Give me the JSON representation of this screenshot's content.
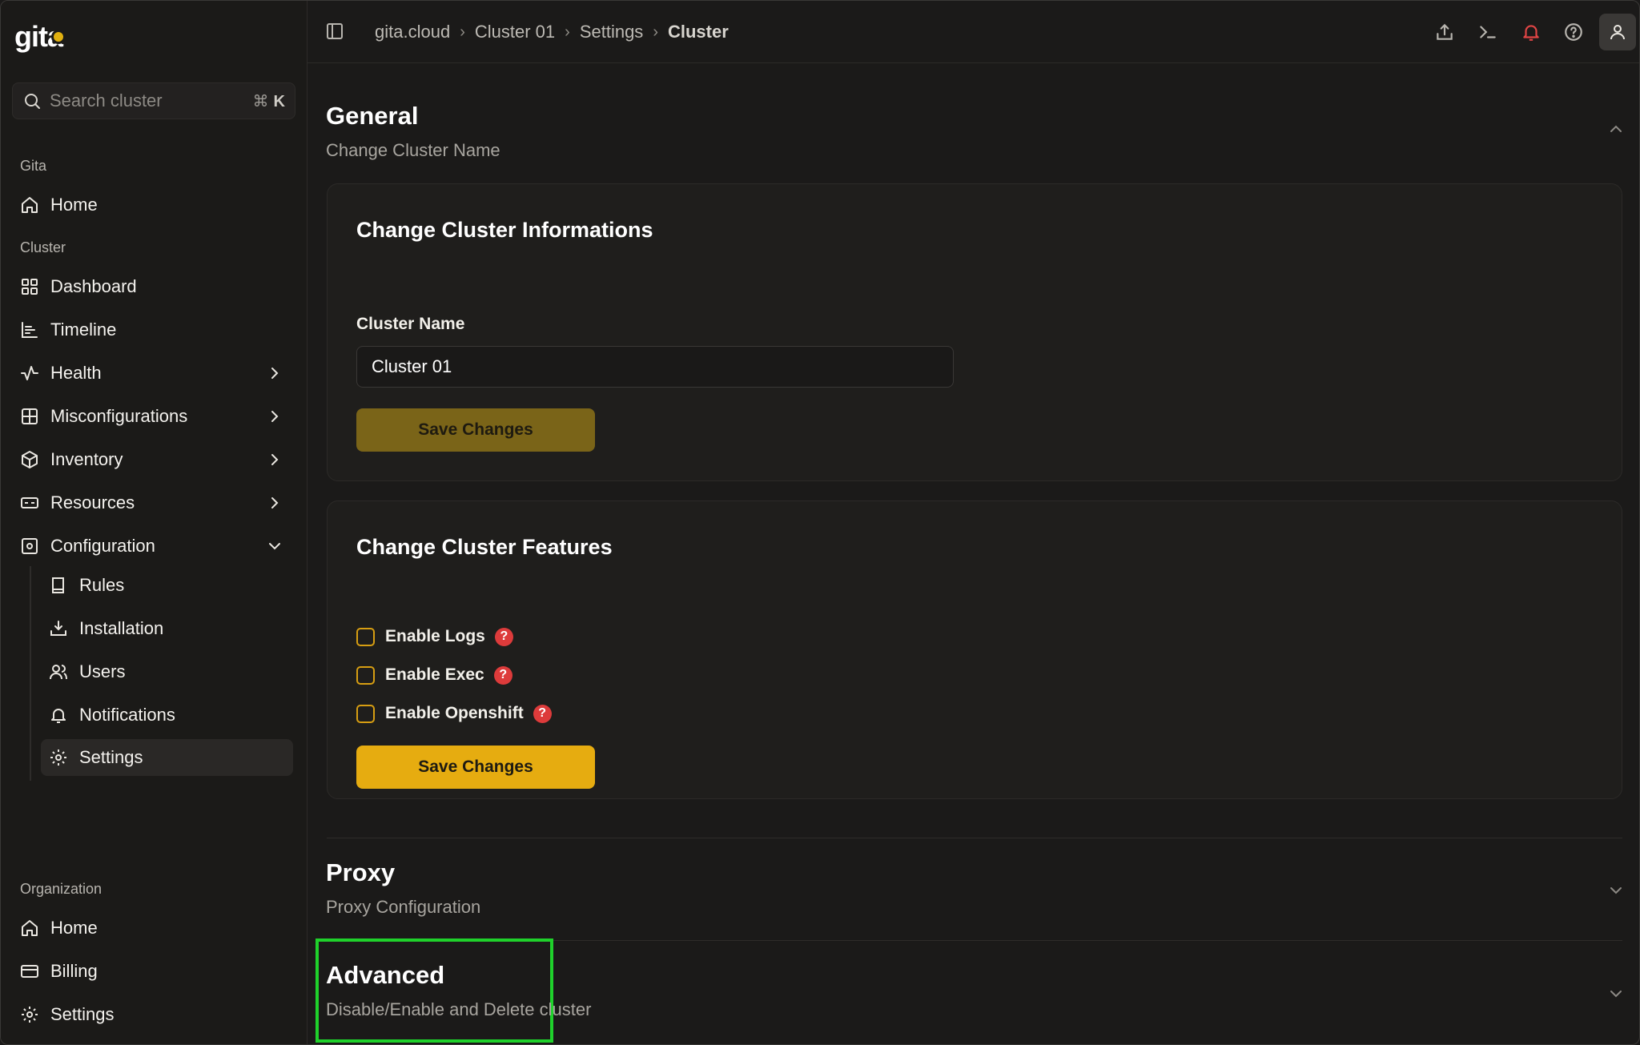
{
  "app": {
    "logo_text": "gita"
  },
  "search": {
    "placeholder": "Search cluster",
    "shortcut_symbol": "⌘",
    "shortcut_key": "K"
  },
  "sidebar": {
    "section_gita": "Gita",
    "gita_items": [
      {
        "label": "Home",
        "icon": "home-icon"
      }
    ],
    "section_cluster": "Cluster",
    "cluster_items": [
      {
        "label": "Dashboard",
        "icon": "grid-icon"
      },
      {
        "label": "Timeline",
        "icon": "timeline-icon"
      },
      {
        "label": "Health",
        "icon": "activity-icon",
        "expandable": true
      },
      {
        "label": "Misconfigurations",
        "icon": "misconfig-icon",
        "expandable": true
      },
      {
        "label": "Inventory",
        "icon": "box-icon",
        "expandable": true
      },
      {
        "label": "Resources",
        "icon": "resources-icon",
        "expandable": true
      },
      {
        "label": "Configuration",
        "icon": "configuration-icon",
        "expanded": true
      }
    ],
    "configuration_items": [
      {
        "label": "Rules",
        "icon": "book-icon"
      },
      {
        "label": "Installation",
        "icon": "install-icon"
      },
      {
        "label": "Users",
        "icon": "users-icon"
      },
      {
        "label": "Notifications",
        "icon": "bell-icon"
      },
      {
        "label": "Settings",
        "icon": "gear-icon",
        "active": true
      }
    ],
    "section_organization": "Organization",
    "organization_items": [
      {
        "label": "Home",
        "icon": "home-icon"
      },
      {
        "label": "Billing",
        "icon": "credit-card-icon"
      },
      {
        "label": "Settings",
        "icon": "gear-icon"
      }
    ]
  },
  "header": {
    "breadcrumbs": [
      "gita.cloud",
      "Cluster 01",
      "Settings",
      "Cluster"
    ],
    "icons": [
      "upload-icon",
      "terminal-icon",
      "bell-icon",
      "help-icon",
      "user-icon"
    ]
  },
  "general": {
    "title": "General",
    "subtitle": "Change Cluster Name",
    "info_card": {
      "title": "Change Cluster Informations",
      "field_label": "Cluster Name",
      "field_value": "Cluster 01",
      "save_label": "Save Changes"
    },
    "features_card": {
      "title": "Change Cluster Features",
      "options": [
        {
          "label": "Enable Logs",
          "checked": false
        },
        {
          "label": "Enable Exec",
          "checked": false
        },
        {
          "label": "Enable Openshift",
          "checked": false
        }
      ],
      "help_glyph": "?",
      "save_label": "Save Changes"
    }
  },
  "proxy": {
    "title": "Proxy",
    "subtitle": "Proxy Configuration"
  },
  "advanced": {
    "title": "Advanced",
    "subtitle": "Disable/Enable and Delete cluster"
  },
  "colors": {
    "accent": "#e6ac10",
    "accent_disabled": "#7a6418",
    "help_badge": "#dd3b3b",
    "highlight": "#1fd12b",
    "background": "#1b1a19"
  }
}
